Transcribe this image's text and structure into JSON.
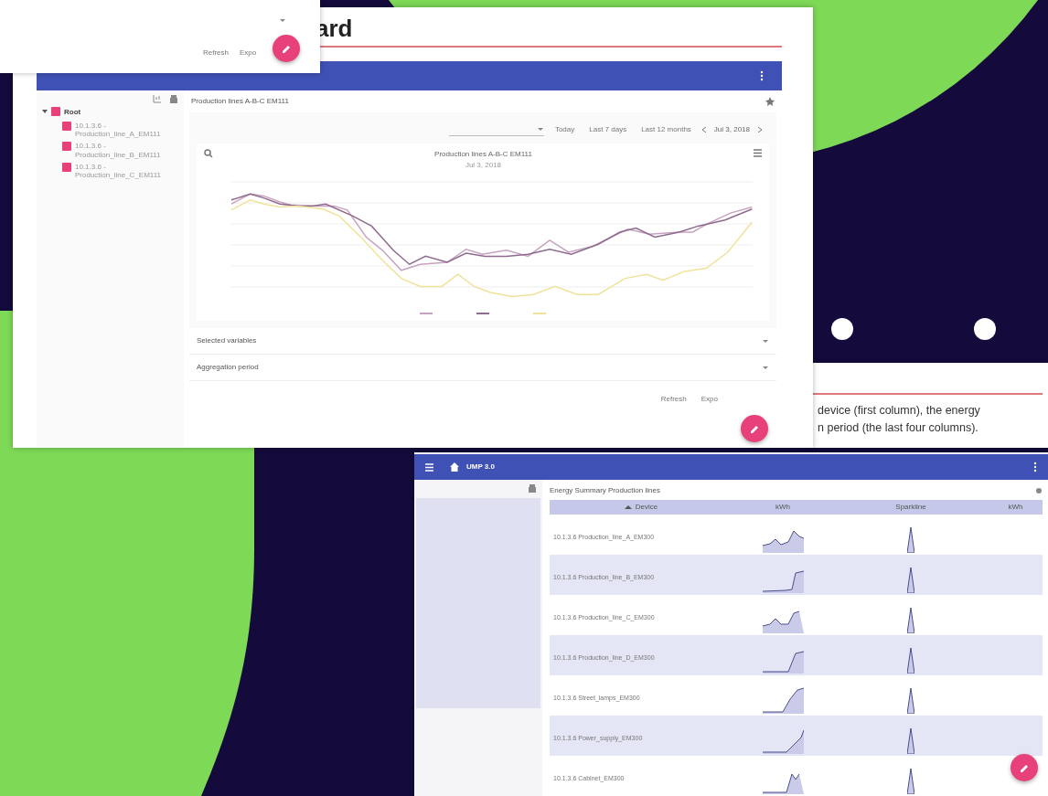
{
  "back_window": {
    "buttons": [
      "Refresh",
      "Expo"
    ]
  },
  "dashboard_window": {
    "heading": "ard",
    "tree": {
      "label": "Root",
      "checked": true,
      "expanded": true,
      "children": [
        {
          "label": "10.1.3.6 - Production_line_A_EM111",
          "checked": true
        },
        {
          "label": "10.1.3.6 - Production_line_B_EM111",
          "checked": true
        },
        {
          "label": "10.1.3.6 - Production_line_C_EM111",
          "checked": true
        }
      ]
    },
    "panel_title": "Production lines A-B-C EM111",
    "range_buttons": [
      "Today",
      "Last 7 days",
      "Last 12 months"
    ],
    "date": "Jul 3, 2018",
    "chart": {
      "title": "Production lines A-B-C EM111",
      "subtitle": "Jul 3, 2018",
      "series": [
        {
          "color": "#c7a3c0"
        },
        {
          "color": "#8e6a8e"
        },
        {
          "color": "#f1e29a"
        }
      ]
    },
    "sections": [
      "Selected variables",
      "Aggregation period"
    ],
    "buttons": [
      "Refresh",
      "Expo"
    ]
  },
  "document": {
    "lines": [
      "device (first column), the energy",
      "n period (the last four columns)."
    ]
  },
  "summary_window": {
    "app_title": "UMP 3.0",
    "panel_title": "Energy Summary Production lines",
    "columns": [
      "Device",
      "kWh",
      "Sparkline",
      "kWh"
    ],
    "rows": [
      {
        "device": "10.1.3.6 Production_line_A_EM300"
      },
      {
        "device": "10.1.3.6 Production_line_B_EM300"
      },
      {
        "device": "10.1.3.6 Production_line_C_EM300"
      },
      {
        "device": "10.1.3.6 Production_line_D_EM300"
      },
      {
        "device": "10.1.3.6 Street_lamps_EM300"
      },
      {
        "device": "10.1.3.6 Power_supply_EM300"
      },
      {
        "device": "10.1.3.6 Cabinet_EM300"
      }
    ]
  }
}
